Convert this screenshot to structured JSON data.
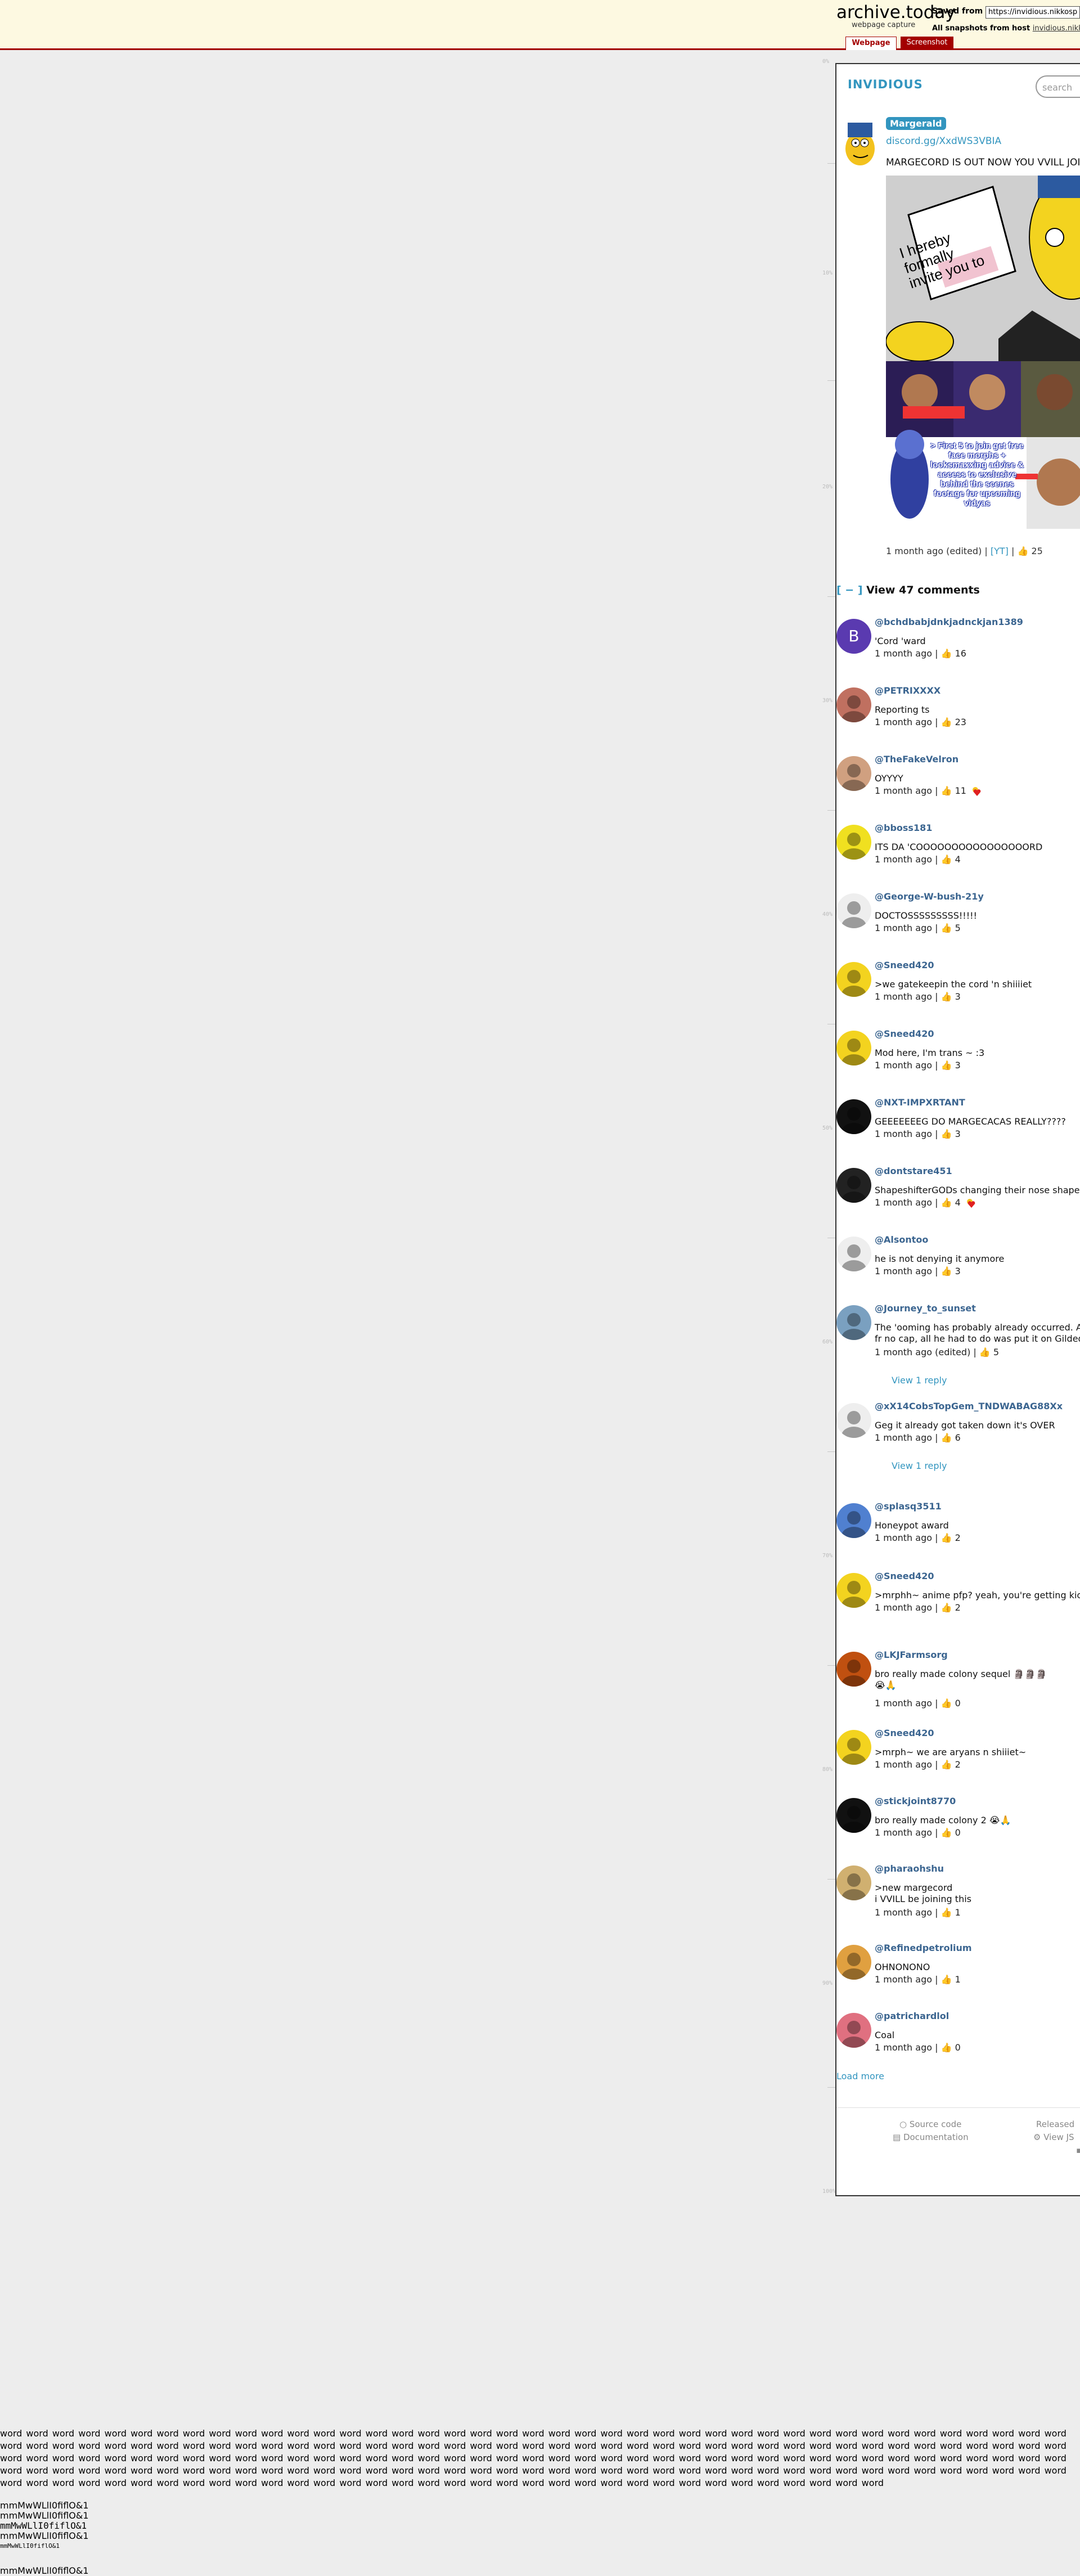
{
  "archive": {
    "brand": "archive.today",
    "subtitle": "webpage capture",
    "saved_from_label": "Saved from",
    "url": "https://invidious.nikkosp",
    "all_snapshots_label": "All snapshots from host",
    "host": "invidious.nikkosp",
    "tabs": [
      "Webpage",
      "Screenshot"
    ],
    "accent": "#a30000",
    "ruler_marks": [
      "0%",
      "10%",
      "20%",
      "30%",
      "40%",
      "50%",
      "60%",
      "70%",
      "80%",
      "90%",
      "100%"
    ]
  },
  "invidious": {
    "logo": "INVIDIOUS",
    "search_placeholder": "search",
    "accent": "#3295bf"
  },
  "post": {
    "channel": "Margerald",
    "link": "discord.gg/XxdWS3VBIA",
    "text": "MARGECORD IS OUT NOW YOU VVILL JOIN!",
    "image_text_1": "I hereby formally invite you to",
    "image_text_2": "> First 5 to join get free face morphs + looksmaxxing advice & access to exclusive behind the scenes footage for upcoming vidyas",
    "meta_time": "1 month ago (edited) | ",
    "meta_yt": "[YT]",
    "meta_likes": " | 👍 25"
  },
  "comments_header": {
    "collapse": "[ − ]",
    "label": "View 47 comments"
  },
  "comments": [
    {
      "author": "@bchdbabjdnkjadnckjan1389",
      "text": "'Cord 'ward",
      "meta": "1 month ago | 👍 16",
      "heart": false,
      "reply": "",
      "avatar": "B"
    },
    {
      "author": "@PETRIXXXX",
      "text": "Reporting ts",
      "meta": "1 month ago | 👍 23",
      "heart": false,
      "reply": "",
      "avatar": ""
    },
    {
      "author": "@TheFakeVelron",
      "text": "OYYYY",
      "meta": "1 month ago | 👍 11",
      "heart": true,
      "reply": "",
      "avatar": ""
    },
    {
      "author": "@bboss181",
      "text": "ITS DA 'COOOOOOOOOOOOOOOORD",
      "meta": "1 month ago | 👍 4",
      "heart": false,
      "reply": "",
      "avatar": ""
    },
    {
      "author": "@George-W-bush-21y",
      "text": "DOCTOSSSSSSSSS!!!!!",
      "meta": "1 month ago | 👍 5",
      "heart": false,
      "reply": "",
      "avatar": ""
    },
    {
      "author": "@Sneed420",
      "text": ">we gatekeepin the cord 'n shiiiiet",
      "meta": "1 month ago | 👍 3",
      "heart": false,
      "reply": "",
      "avatar": ""
    },
    {
      "author": "@Sneed420",
      "text": "Mod here, I'm trans ~ :3",
      "meta": "1 month ago | 👍 3",
      "heart": false,
      "reply": "",
      "avatar": ""
    },
    {
      "author": "@NXT-IMPXRTANT",
      "text": "GEEEEEEEG DO MARGECACAS REALLY????",
      "meta": "1 month ago | 👍 3",
      "heart": false,
      "reply": "",
      "avatar": ""
    },
    {
      "author": "@dontstare451",
      "text": "ShapeshifterGODs changing their nose shape",
      "meta": "1 month ago | 👍 4",
      "heart": true,
      "reply": "",
      "avatar": ""
    },
    {
      "author": "@Alsontoo",
      "text": "he is not denying it anymore",
      "meta": "1 month ago | 👍 3",
      "heart": false,
      "reply": "",
      "avatar": ""
    },
    {
      "author": "@Journey_to_sunset",
      "text": "The 'ooming has probably already occurred. A\nfr no cap, all he had to do was put it on Gilded",
      "meta": "1 month ago (edited) | 👍 5",
      "heart": false,
      "reply": "View 1 reply",
      "avatar": ""
    },
    {
      "author": "@xX14CobsTopGem_TNDWABAG88Xx",
      "text": "Geg it already got taken down it's OVER",
      "meta": "1 month ago | 👍 6",
      "heart": false,
      "reply": "View 1 reply",
      "avatar": ""
    },
    {
      "author": "@splasq3511",
      "text": "Honeypot award",
      "meta": "1 month ago | 👍 2",
      "heart": false,
      "reply": "",
      "avatar": ""
    },
    {
      "author": "@Sneed420",
      "text": ">mrphh~ anime pfp? yeah, you're getting kic",
      "meta": "1 month ago | 👍 2",
      "heart": false,
      "reply": "",
      "avatar": ""
    },
    {
      "author": "@LKJFarmsorg",
      "text": "bro really made colony sequel 🗿🗿🗿\n😭🙏",
      "meta": "1 month ago | 👍 0",
      "heart": false,
      "reply": "",
      "avatar": ""
    },
    {
      "author": "@Sneed420",
      "text": ">mrph~ we are aryans n shiiiet~",
      "meta": "1 month ago | 👍 2",
      "heart": false,
      "reply": "",
      "avatar": ""
    },
    {
      "author": "@stickjoint8770",
      "text": "bro really made colony 2 😭🙏",
      "meta": "1 month ago | 👍 0",
      "heart": false,
      "reply": "",
      "avatar": ""
    },
    {
      "author": "@pharaohshu",
      "text": ">new margecord\ni VVILL be joining this",
      "meta": "1 month ago | 👍 1",
      "heart": false,
      "reply": "",
      "avatar": ""
    },
    {
      "author": "@Refinedpetrolium",
      "text": "OHNONONO",
      "meta": "1 month ago | 👍 1",
      "heart": false,
      "reply": "",
      "avatar": ""
    },
    {
      "author": "@patrichardlol",
      "text": "Coal",
      "meta": "1 month ago | 👍 0",
      "heart": false,
      "reply": "",
      "avatar": ""
    }
  ],
  "load_more": "Load more",
  "footer": {
    "source": "Source code",
    "docs": "Documentation",
    "released": "Released",
    "view": "View JS"
  },
  "junk": {
    "words": "word word word word word word word word word word word word word word word word word word word word word word word word word word word word word word word word word word word word word word word word word word word word word word word word word word word word word word word word word word word word word word word word word word word word word word word word word word word word word word word word word word word word word word word word word word word word word word word word word word word word word word word word word word word word word word word word word word word word word word word word word word word word word word word word word word word word word word word word word word word word word word word word word word word word word word word word word word word word word word word word word word word word word word word word word word word word word word word word word word word word word word word word word word word word word word word word word word word word word word",
    "lines": [
      "mmMwWLlI0fiflO&1",
      "mmMwWLlI0fiflO&1",
      "mmMwWLlI0fiflO&1",
      "mmMwWLlI0fiflO&1",
      "mmMwWLlI0fiflO&1",
      "",
      "mmMwWLlI0fiflO&1"
    ]
  }
}
